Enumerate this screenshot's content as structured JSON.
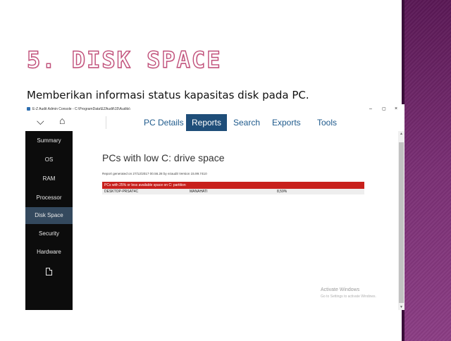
{
  "slide": {
    "title": "5. DISK SPACE",
    "subtitle": "Memberikan informasi status kapasitas disk pada PC."
  },
  "window": {
    "title": "E-Z Audit Admin Console - C:\\ProgramData\\EZAudit\\15\\Audits\\",
    "controls": {
      "minimize": "–",
      "maximize": "▢",
      "close": "×"
    }
  },
  "toolbar": {
    "back_icon": "chevron-down-icon",
    "back_glyph": "⌵",
    "home_icon": "home-icon",
    "home_glyph": "⌂"
  },
  "tabs": [
    {
      "label": "PC Details",
      "active": false
    },
    {
      "label": "Reports",
      "active": true
    },
    {
      "label": "Search",
      "active": false
    },
    {
      "label": "Exports",
      "active": false
    },
    {
      "label": "Tools",
      "active": false
    }
  ],
  "sidebar": {
    "items": [
      {
        "label": "Summary",
        "active": false
      },
      {
        "label": "OS",
        "active": false
      },
      {
        "label": "RAM",
        "active": false
      },
      {
        "label": "Processor",
        "active": false
      },
      {
        "label": "Disk Space",
        "active": true
      },
      {
        "label": "Security",
        "active": false
      },
      {
        "label": "Hardware",
        "active": false
      }
    ],
    "footer_icon": "document-icon"
  },
  "report": {
    "title": "PCs with low C: drive space",
    "meta": "Report generated on 27/12/2017 00.56.28 by ezaudit Version 15.99.7410",
    "table_header": "PCs with 25% or less available space on C: partition",
    "rows": [
      {
        "pc": "DESKTOP-PRSAT4C",
        "user": "MANAHATI",
        "percent": "8,59%"
      }
    ]
  },
  "watermark": {
    "line1": "Activate Windows",
    "line2": "Go to Settings to activate Windows."
  },
  "colors": {
    "accent": "#1f4e79",
    "header_red": "#c8201c",
    "sidebar_bg": "#0c0c0c",
    "sidebar_active": "#34495e",
    "slide_bar": "#6b2466"
  }
}
